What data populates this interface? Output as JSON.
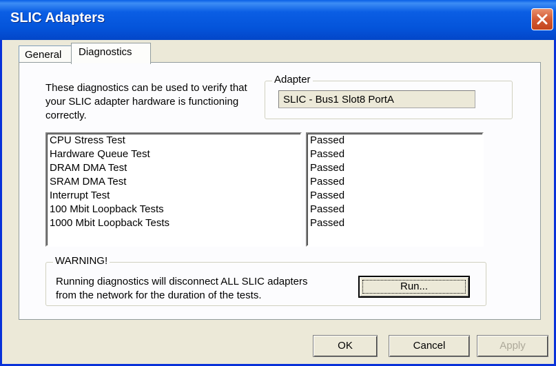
{
  "window": {
    "title": "SLIC Adapters"
  },
  "tabs": [
    {
      "label": "General",
      "selected": false
    },
    {
      "label": "Diagnostics",
      "selected": true
    }
  ],
  "diagnostics": {
    "description": "These diagnostics can be used to verify that your SLIC adapter hardware is functioning correctly.",
    "adapter": {
      "legend": "Adapter",
      "value": "SLIC - Bus1 Slot8 PortA"
    },
    "tests": [
      "CPU Stress Test",
      "Hardware Queue Test",
      "DRAM DMA Test",
      "SRAM DMA Test",
      "Interrupt Test",
      "100 Mbit Loopback Tests",
      "1000 Mbit Loopback Tests"
    ],
    "results": [
      "Passed",
      "Passed",
      "Passed",
      "Passed",
      "Passed",
      "Passed",
      "Passed"
    ],
    "warning": {
      "legend": "WARNING!",
      "line1": "Running diagnostics will disconnect ALL SLIC adapters",
      "line2": "from the network for the duration of the tests.",
      "run_label": "Run..."
    }
  },
  "buttons": {
    "ok": "OK",
    "cancel": "Cancel",
    "apply": "Apply",
    "apply_enabled": false
  },
  "colors": {
    "titlebar": "#0454da",
    "close": "#d35a34",
    "dialog_bg": "#ece9d8"
  }
}
